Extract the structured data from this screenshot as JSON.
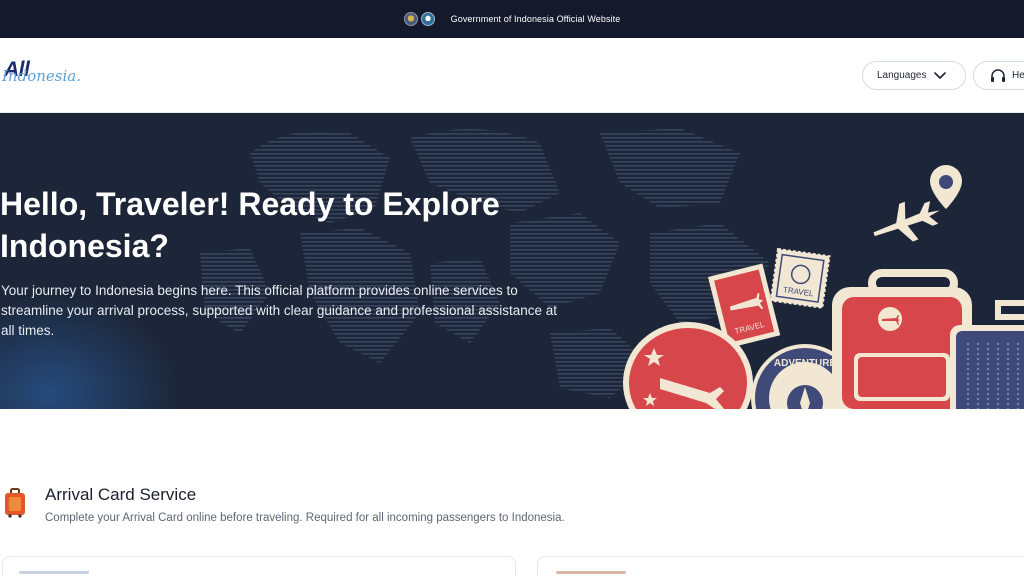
{
  "gov_bar": {
    "text": "Government of Indonesia Official Website",
    "icons": [
      "national-emblem-icon",
      "ministry-emblem-icon"
    ]
  },
  "header": {
    "logo": {
      "primary": "All",
      "secondary": "Indonesia."
    },
    "languages_label": "Languages",
    "help_label": "He",
    "icons": [
      "chevron-down-icon",
      "headset-icon"
    ]
  },
  "hero": {
    "title": "Hello, Traveler! Ready to Explore Indonesia?",
    "description": "Your journey to Indonesia begins here. This official platform provides online services to streamline your arrival process, supported with clear guidance and professional assistance at all times.",
    "stamp_travel_1": "TRAVEL",
    "stamp_travel_2": "TRAVEL",
    "stamp_adventure": "ADVENTURE",
    "colors": {
      "background": "#1c2638",
      "accent_red": "#d7464a",
      "cream": "#f1e7d3",
      "navy": "#3f4a78"
    }
  },
  "section": {
    "title": "Arrival Card Service",
    "subtitle": "Complete your Arrival Card online before traveling. Required for all incoming passengers to Indonesia.",
    "icon": "suitcase-icon"
  }
}
